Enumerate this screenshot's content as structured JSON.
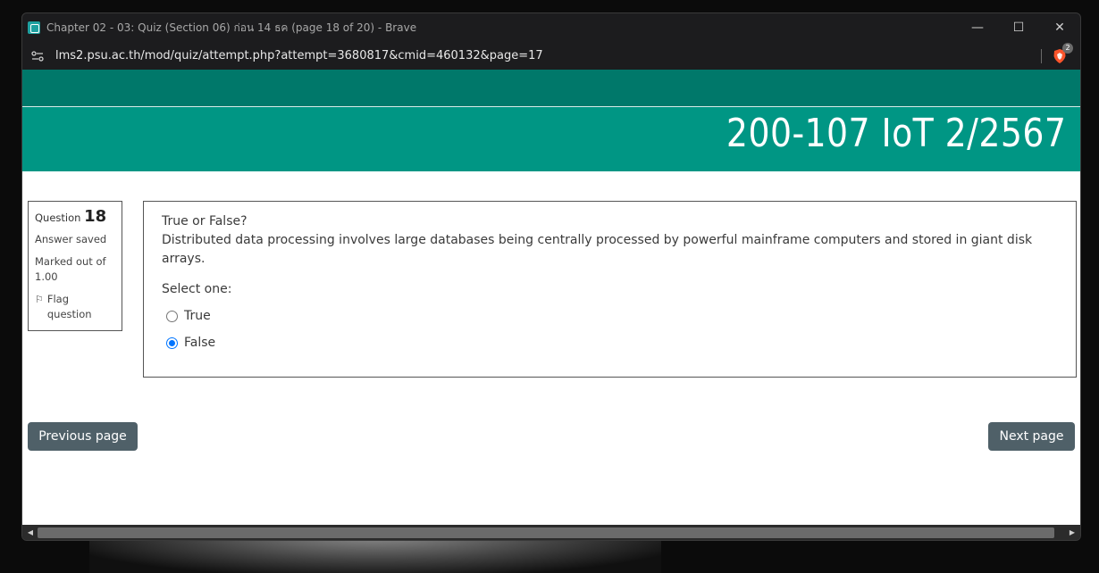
{
  "window": {
    "title": "Chapter 02 - 03: Quiz (Section 06) ก่อน 14 ธค (page 18 of 20) - Brave",
    "controls": {
      "minimize": "—",
      "maximize": "☐",
      "close": "✕"
    }
  },
  "addressbar": {
    "url": "lms2.psu.ac.th/mod/quiz/attempt.php?attempt=3680817&cmid=460132&page=17",
    "shield_count": "2"
  },
  "course": {
    "title": "200-107 IoT 2/2567"
  },
  "question_info": {
    "label": "Question",
    "number": "18",
    "state": "Answer saved",
    "grade": "Marked out of 1.00",
    "flag_label": "Flag question"
  },
  "question": {
    "line1": "True or False?",
    "line2": "Distributed data processing involves large databases being centrally processed by powerful mainframe computers and stored in giant disk arrays.",
    "prompt": "Select one:",
    "options": [
      {
        "label": "True",
        "checked": false
      },
      {
        "label": "False",
        "checked": true
      }
    ]
  },
  "navigation": {
    "previous": "Previous page",
    "next": "Next page"
  },
  "colors": {
    "banner_dark": "#00786a",
    "banner": "#009684",
    "button": "#4f6068"
  }
}
